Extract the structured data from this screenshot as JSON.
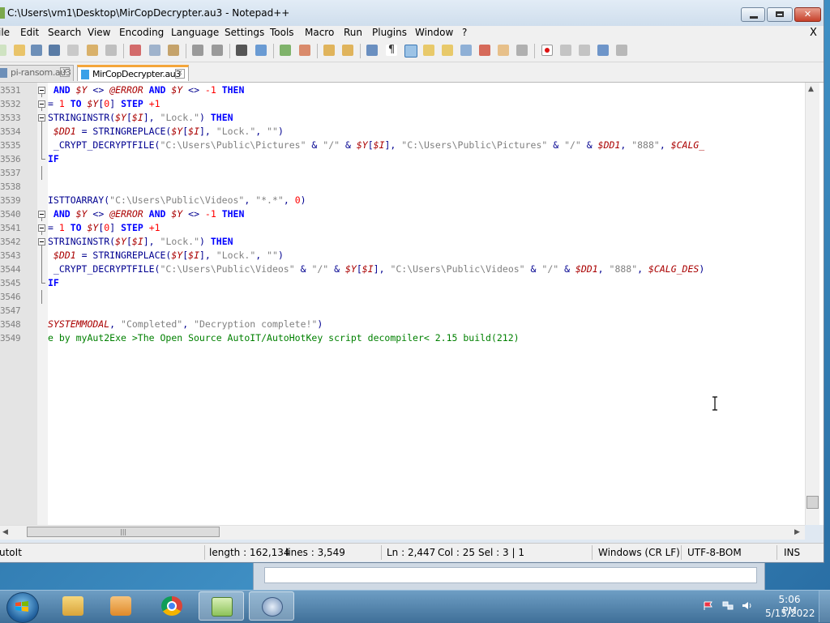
{
  "window": {
    "title": "C:\\Users\\vm1\\Desktop\\MirCopDecrypter.au3 - Notepad++",
    "min_glyph": "",
    "close_glyph": "✕"
  },
  "menu": {
    "items": [
      "ile",
      "Edit",
      "Search",
      "View",
      "Encoding",
      "Language",
      "Settings",
      "Tools",
      "Macro",
      "Run",
      "Plugins",
      "Window",
      "?"
    ],
    "close": "X"
  },
  "tabs": [
    {
      "label": "pi-ransom.au3",
      "active": false
    },
    {
      "label": "MirCopDecrypter.au3",
      "active": true
    }
  ],
  "editor": {
    "lines": [
      {
        "num": "3531",
        "mark": "box"
      },
      {
        "num": "3532",
        "mark": "box"
      },
      {
        "num": "3533",
        "mark": "box"
      },
      {
        "num": "3534",
        "mark": "line"
      },
      {
        "num": "3535",
        "mark": "line"
      },
      {
        "num": "3536",
        "mark": "end"
      },
      {
        "num": "3537",
        "mark": "line"
      },
      {
        "num": "3538",
        "mark": "none"
      },
      {
        "num": "3539",
        "mark": "none"
      },
      {
        "num": "3540",
        "mark": "box"
      },
      {
        "num": "3541",
        "mark": "box"
      },
      {
        "num": "3542",
        "mark": "box"
      },
      {
        "num": "3543",
        "mark": "line"
      },
      {
        "num": "3544",
        "mark": "line"
      },
      {
        "num": "3545",
        "mark": "end"
      },
      {
        "num": "3546",
        "mark": "line"
      },
      {
        "num": "3547",
        "mark": "none"
      },
      {
        "num": "3548",
        "mark": "none"
      },
      {
        "num": "3549",
        "mark": "none"
      }
    ],
    "code": [
      [
        [
          "kw",
          " AND "
        ],
        [
          "vr",
          "$Y"
        ],
        [
          "fn",
          " <> "
        ],
        [
          "vr",
          "@ERROR"
        ],
        [
          "kw",
          " AND "
        ],
        [
          "vr",
          "$Y"
        ],
        [
          "fn",
          " <> "
        ],
        [
          "nm",
          "-1"
        ],
        [
          "kw",
          " THEN"
        ]
      ],
      [
        [
          "fn",
          "= "
        ],
        [
          "nm",
          "1"
        ],
        [
          "kw",
          " TO "
        ],
        [
          "vr",
          "$Y"
        ],
        [
          "fn",
          "["
        ],
        [
          "nm",
          "0"
        ],
        [
          "fn",
          "]"
        ],
        [
          "kw",
          " STEP "
        ],
        [
          "nm",
          "+1"
        ]
      ],
      [
        [
          "fn",
          "STRINGINSTR("
        ],
        [
          "vr",
          "$Y"
        ],
        [
          "fn",
          "["
        ],
        [
          "vr",
          "$I"
        ],
        [
          "fn",
          "], "
        ],
        [
          "st",
          "\"Lock.\""
        ],
        [
          "fn",
          ")"
        ],
        [
          "kw",
          " THEN"
        ]
      ],
      [
        [
          "fn",
          " "
        ],
        [
          "vr",
          "$DD1"
        ],
        [
          "fn",
          " = STRINGREPLACE("
        ],
        [
          "vr",
          "$Y"
        ],
        [
          "fn",
          "["
        ],
        [
          "vr",
          "$I"
        ],
        [
          "fn",
          "], "
        ],
        [
          "st",
          "\"Lock.\""
        ],
        [
          "fn",
          ", "
        ],
        [
          "st",
          "\"\""
        ],
        [
          "fn",
          ")"
        ]
      ],
      [
        [
          "fn",
          " _CRYPT_DECRYPTFILE("
        ],
        [
          "st",
          "\"C:\\Users\\Public\\Pictures\""
        ],
        [
          "fn",
          " & "
        ],
        [
          "st",
          "\"/\""
        ],
        [
          "fn",
          " & "
        ],
        [
          "vr",
          "$Y"
        ],
        [
          "fn",
          "["
        ],
        [
          "vr",
          "$I"
        ],
        [
          "fn",
          "], "
        ],
        [
          "st",
          "\"C:\\Users\\Public\\Pictures\""
        ],
        [
          "fn",
          " & "
        ],
        [
          "st",
          "\"/\""
        ],
        [
          "fn",
          " & "
        ],
        [
          "vr",
          "$DD1"
        ],
        [
          "fn",
          ", "
        ],
        [
          "st",
          "\"888\""
        ],
        [
          "fn",
          ", "
        ],
        [
          "vr",
          "$CALG_"
        ]
      ],
      [
        [
          "kw",
          "IF"
        ]
      ],
      [],
      [],
      [
        [
          "fn",
          "ISTTOARRAY("
        ],
        [
          "st",
          "\"C:\\Users\\Public\\Videos\""
        ],
        [
          "fn",
          ", "
        ],
        [
          "st",
          "\"*.*\""
        ],
        [
          "fn",
          ", "
        ],
        [
          "nm",
          "0"
        ],
        [
          "fn",
          ")"
        ]
      ],
      [
        [
          "kw",
          " AND "
        ],
        [
          "vr",
          "$Y"
        ],
        [
          "fn",
          " <> "
        ],
        [
          "vr",
          "@ERROR"
        ],
        [
          "kw",
          " AND "
        ],
        [
          "vr",
          "$Y"
        ],
        [
          "fn",
          " <> "
        ],
        [
          "nm",
          "-1"
        ],
        [
          "kw",
          " THEN"
        ]
      ],
      [
        [
          "fn",
          "= "
        ],
        [
          "nm",
          "1"
        ],
        [
          "kw",
          " TO "
        ],
        [
          "vr",
          "$Y"
        ],
        [
          "fn",
          "["
        ],
        [
          "nm",
          "0"
        ],
        [
          "fn",
          "]"
        ],
        [
          "kw",
          " STEP "
        ],
        [
          "nm",
          "+1"
        ]
      ],
      [
        [
          "fn",
          "STRINGINSTR("
        ],
        [
          "vr",
          "$Y"
        ],
        [
          "fn",
          "["
        ],
        [
          "vr",
          "$I"
        ],
        [
          "fn",
          "], "
        ],
        [
          "st",
          "\"Lock.\""
        ],
        [
          "fn",
          ")"
        ],
        [
          "kw",
          " THEN"
        ]
      ],
      [
        [
          "fn",
          " "
        ],
        [
          "vr",
          "$DD1"
        ],
        [
          "fn",
          " = STRINGREPLACE("
        ],
        [
          "vr",
          "$Y"
        ],
        [
          "fn",
          "["
        ],
        [
          "vr",
          "$I"
        ],
        [
          "fn",
          "], "
        ],
        [
          "st",
          "\"Lock.\""
        ],
        [
          "fn",
          ", "
        ],
        [
          "st",
          "\"\""
        ],
        [
          "fn",
          ")"
        ]
      ],
      [
        [
          "fn",
          " _CRYPT_DECRYPTFILE("
        ],
        [
          "st",
          "\"C:\\Users\\Public\\Videos\""
        ],
        [
          "fn",
          " & "
        ],
        [
          "st",
          "\"/\""
        ],
        [
          "fn",
          " & "
        ],
        [
          "vr",
          "$Y"
        ],
        [
          "fn",
          "["
        ],
        [
          "vr",
          "$I"
        ],
        [
          "fn",
          "], "
        ],
        [
          "st",
          "\"C:\\Users\\Public\\Videos\""
        ],
        [
          "fn",
          " & "
        ],
        [
          "st",
          "\"/\""
        ],
        [
          "fn",
          " & "
        ],
        [
          "vr",
          "$DD1"
        ],
        [
          "fn",
          ", "
        ],
        [
          "st",
          "\"888\""
        ],
        [
          "fn",
          ", "
        ],
        [
          "vr",
          "$CALG_DES"
        ],
        [
          "fn",
          ")"
        ]
      ],
      [
        [
          "kw",
          "IF"
        ]
      ],
      [],
      [],
      [
        [
          "vr",
          "SYSTEMMODAL"
        ],
        [
          "fn",
          ", "
        ],
        [
          "st",
          "\"Completed\""
        ],
        [
          "fn",
          ", "
        ],
        [
          "st",
          "\"Decryption complete!\""
        ],
        [
          "fn",
          ")"
        ]
      ],
      [
        [
          "cm",
          "e by myAut2Exe >The Open Source AutoIT/AutoHotKey script decompiler< 2.15 build(212)"
        ]
      ]
    ]
  },
  "hscroll": {
    "grip": "|||"
  },
  "status": {
    "language": "utoIt",
    "length": "length : 162,134",
    "lines": "lines : 3,549",
    "ln": "Ln : 2,447",
    "col": "Col : 25",
    "sel": "Sel : 3 | 1",
    "eol": "Windows (CR LF)",
    "encoding": "UTF-8-BOM",
    "mode": "INS"
  },
  "clock": {
    "time": "5:06 PM",
    "date": "5/15/2022"
  },
  "colors": {
    "keyword": "#0000ff",
    "variable": "#aa0000",
    "string": "#808080",
    "number": "#ff0000",
    "comment": "#008000",
    "tab_accent": "#f4a63a"
  }
}
